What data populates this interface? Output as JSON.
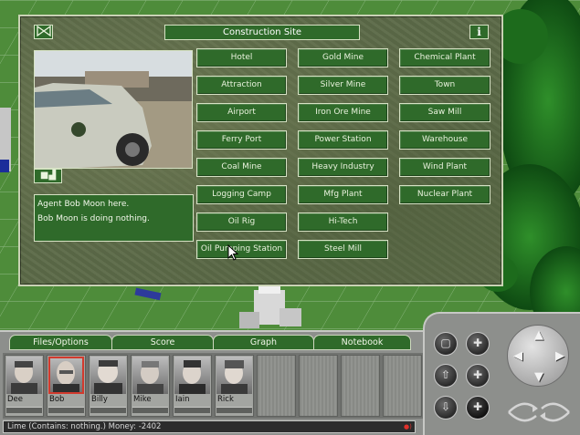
{
  "dialog": {
    "title": "Construction Site",
    "info_label": "i",
    "agent_lines": [
      "Agent Bob Moon here.",
      "Bob Moon is doing nothing."
    ],
    "buttons": [
      [
        "Hotel",
        "Gold Mine",
        "Chemical Plant"
      ],
      [
        "Attraction",
        "Silver Mine",
        "Town"
      ],
      [
        "Airport",
        "Iron Ore Mine",
        "Saw Mill"
      ],
      [
        "Ferry Port",
        "Power Station",
        "Warehouse"
      ],
      [
        "Coal Mine",
        "Heavy Industry",
        "Wind Plant"
      ],
      [
        "Logging Camp",
        "Mfg Plant",
        "Nuclear Plant"
      ],
      [
        "Oil Rig",
        "Hi-Tech",
        ""
      ],
      [
        "Oil Pumping Station",
        "Steel Mill",
        ""
      ]
    ]
  },
  "tabs": [
    "Files/Options",
    "Score",
    "Graph",
    "Notebook"
  ],
  "agents": [
    "Dee",
    "Bob",
    "Billy",
    "Mike",
    "Iain",
    "Rick"
  ],
  "selected_agent": "Bob",
  "status": {
    "text": "Lime    (Contains: nothing.)  Money: -2402"
  },
  "colors": {
    "button_green": "#2f6a2a",
    "border_light": "#d6e2c4",
    "selected_red": "#d23a2d"
  },
  "icons": {
    "close": "close-icon",
    "info": "info-icon",
    "cursor": "mouse-pointer-icon"
  }
}
